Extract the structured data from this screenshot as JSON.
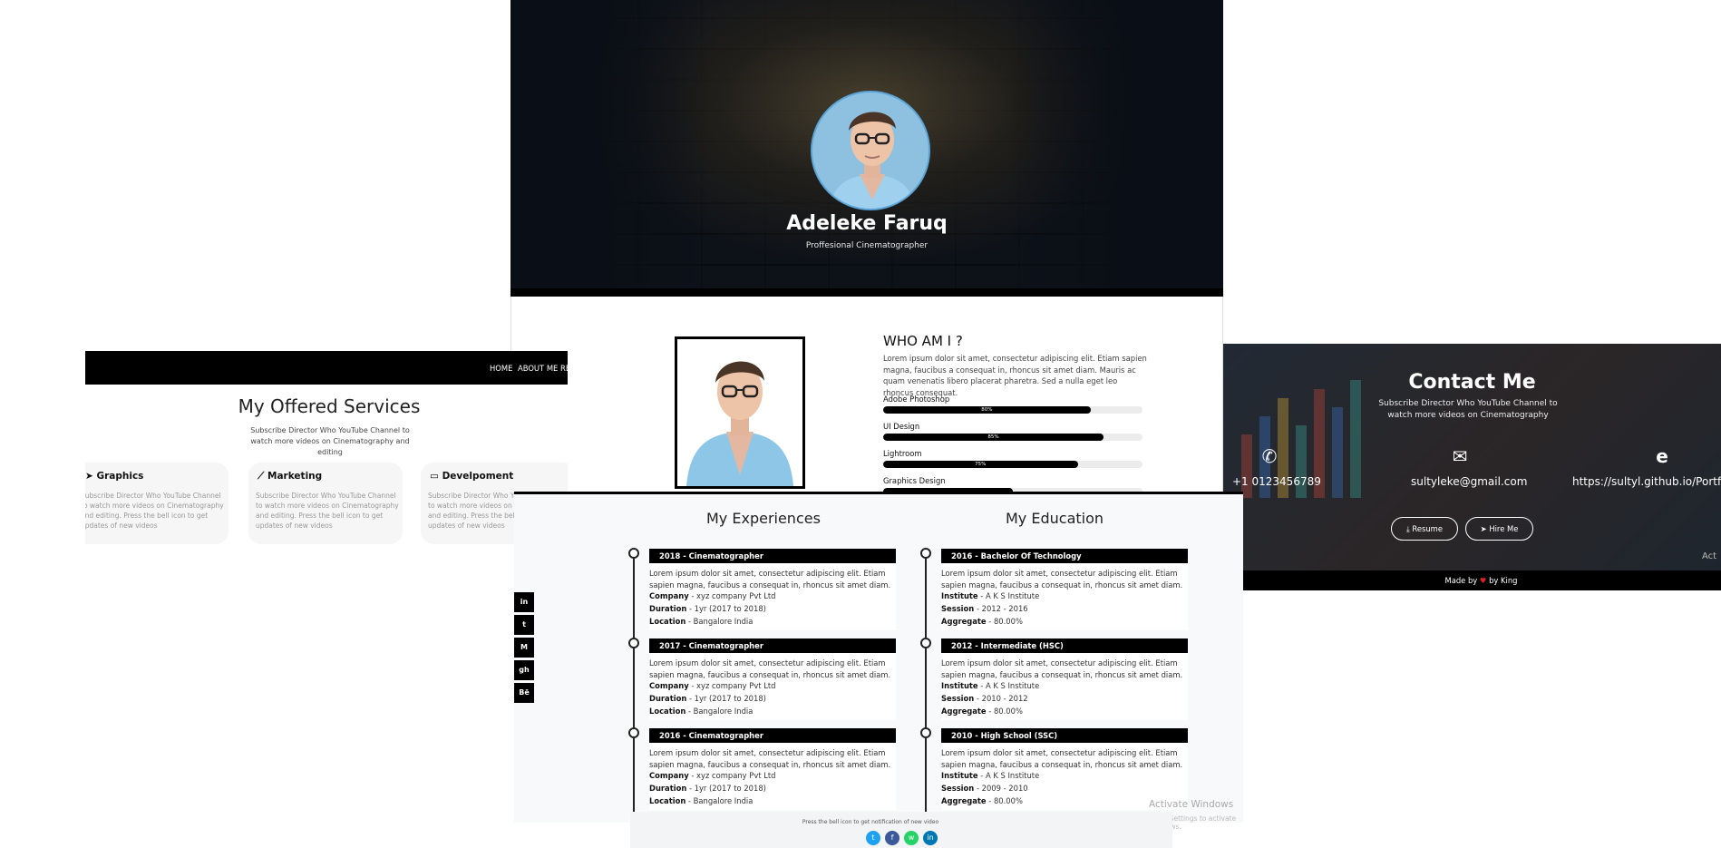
{
  "hero": {
    "name": "Adeleke Faruq",
    "role": "Proffesional Cinematographer"
  },
  "about": {
    "title": "WHO AM I ?",
    "text": "Lorem ipsum dolor sit amet, consectetur adipiscing elit. Etiam sapien magna, faucibus a consequat in, rhoncus sit amet diam. Mauris ac quam venenatis libero placerat pharetra. Sed a nulla eget leo rhoncus consequat.",
    "skills": [
      {
        "label": "Adobe Photoshop",
        "percent": 80,
        "percent_label": "80%"
      },
      {
        "label": "UI Design",
        "percent": 85,
        "percent_label": "85%"
      },
      {
        "label": "Lightroom",
        "percent": 75,
        "percent_label": "75%"
      },
      {
        "label": "Graphics Design",
        "percent": 50,
        "percent_label": ""
      }
    ]
  },
  "services": {
    "nav": [
      "HOME",
      "ABOUT ME",
      "RE"
    ],
    "title": "My Offered Services",
    "subtitle": "Subscribe Director Who YouTube Channel to watch more videos on Cinematography and editing",
    "cards": [
      {
        "title": "Graphics",
        "icon": "paper-plane-icon",
        "text": "Subscribe Director Who YouTube Channel to watch more videos on Cinematography and editing. Press the bell icon to get updates of new videos"
      },
      {
        "title": "Marketing",
        "icon": "chart-line-icon",
        "text": "Subscribe Director Who YouTube Channel to watch more videos on Cinematography and editing. Press the bell icon to get updates of new videos"
      },
      {
        "title": "Develpoment",
        "icon": "laptop-icon",
        "text": "Subscribe Director Who YouTube Channel to watch more videos on Cinematography and editing. Press the bell icon to get updates of new videos"
      }
    ]
  },
  "contact": {
    "title": "Contact Me",
    "subtitle": "Subscribe Director Who YouTube Channel to watch more videos on Cinematography",
    "phone": "+1 0123456789",
    "email": "sultyleke@gmail.com",
    "website": "https://sultyl.github.io/Portfolio",
    "resume_label": "Resume",
    "hire_label": "Hire Me",
    "footer_made": "Made by",
    "footer_by": "by King",
    "activate_text": "Act"
  },
  "experience": {
    "title": "My Experiences",
    "items": [
      {
        "head": "2018 - Cinematographer",
        "desc": "Lorem ipsum dolor sit amet, consectetur adipiscing elit. Etiam sapien magna, faucibus a consequat in, rhoncus sit amet diam.",
        "k1": "Company",
        "v1": " - xyz company Pvt Ltd",
        "k2": "Duration",
        "v2": " - 1yr (2017 to 2018)",
        "k3": "Location",
        "v3": " - Bangalore India"
      },
      {
        "head": "2017 - Cinematographer",
        "desc": "Lorem ipsum dolor sit amet, consectetur adipiscing elit. Etiam sapien magna, faucibus a consequat in, rhoncus sit amet diam.",
        "k1": "Company",
        "v1": " - xyz company Pvt Ltd",
        "k2": "Duration",
        "v2": " - 1yr (2017 to 2018)",
        "k3": "Location",
        "v3": " - Bangalore India"
      },
      {
        "head": "2016 - Cinematographer",
        "desc": "Lorem ipsum dolor sit amet, consectetur adipiscing elit. Etiam sapien magna, faucibus a consequat in, rhoncus sit amet diam.",
        "k1": "Company",
        "v1": " - xyz company Pvt Ltd",
        "k2": "Duration",
        "v2": " - 1yr (2017 to 2018)",
        "k3": "Location",
        "v3": " - Bangalore India"
      }
    ]
  },
  "education": {
    "title": "My Education",
    "items": [
      {
        "head": "2016 - Bachelor Of Technology",
        "desc": "Lorem ipsum dolor sit amet, consectetur adipiscing elit. Etiam sapien magna, faucibus a consequat in, rhoncus sit amet diam.",
        "k1": "Institute",
        "v1": " - A K S Institute",
        "k2": "Session",
        "v2": " - 2012 - 2016",
        "k3": "Aggregate",
        "v3": " - 80.00%"
      },
      {
        "head": "2012 - Intermediate (HSC)",
        "desc": "Lorem ipsum dolor sit amet, consectetur adipiscing elit. Etiam sapien magna, faucibus a consequat in, rhoncus sit amet diam.",
        "k1": "Institute",
        "v1": " - A K S Institute",
        "k2": "Session",
        "v2": " - 2010 - 2012",
        "k3": "Aggregate",
        "v3": " - 80.00%"
      },
      {
        "head": "2010 - High School (SSC)",
        "desc": "Lorem ipsum dolor sit amet, consectetur adipiscing elit. Etiam sapien magna, faucibus a consequat in, rhoncus sit amet diam.",
        "k1": "Institute",
        "v1": " - A K S Institute",
        "k2": "Session",
        "v2": " - 2009 - 2010",
        "k3": "Aggregate",
        "v3": " - 80.00%"
      }
    ]
  },
  "social_sidebar": [
    "in",
    "t",
    "M",
    "gh",
    "Bē"
  ],
  "windows": {
    "activate_title": "Activate Windows",
    "activate_sub": "Go to Settings to activate Windows."
  },
  "footer": {
    "text": "Press the bell icon to get notification of new video"
  },
  "colors": {
    "accent": "#000000",
    "hero_ring": "#5aa4d8",
    "heart": "#e0201e"
  }
}
